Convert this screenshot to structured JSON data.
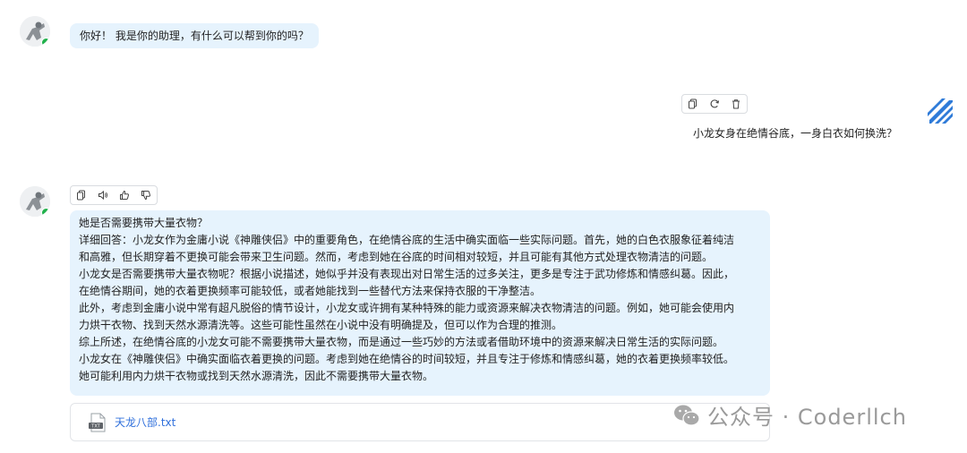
{
  "messages": {
    "greeting": "你好！ 我是你的助理，有什么可以帮到你的吗？",
    "user_question": "小龙女身在绝情谷底，一身白衣如何换洗？",
    "answer_lines": [
      "她是否需要携带大量衣物？",
      "详细回答：小龙女作为金庸小说《神雕侠侣》中的重要角色，在绝情谷底的生活中确实面临一些实际问题。首先，她的白色衣服象征着纯洁",
      "和高雅，但长期穿着不更换可能会带来卫生问题。然而，考虑到她在谷底的时间相对较短，并且可能有其他方式处理衣物清洁的问题。",
      "小龙女是否需要携带大量衣物呢？根据小说描述，她似乎并没有表现出对日常生活的过多关注，更多是专注于武功修炼和情感纠葛。因此，",
      "在绝情谷期间，她的衣着更换频率可能较低，或者她能找到一些替代方法来保持衣服的干净整洁。",
      "此外，考虑到金庸小说中常有超凡脱俗的情节设计，小龙女或许拥有某种特殊的能力或资源来解决衣物清洁的问题。例如，她可能会使用内",
      "力烘干衣物、找到天然水源清洗等。这些可能性虽然在小说中没有明确提及，但可以作为合理的推测。",
      "综上所述，在绝情谷底的小龙女可能不需要携带大量衣物，而是通过一些巧妙的方法或者借助环境中的资源来解决日常生活的实际问题。",
      "小龙女在《神雕侠侣》中确实面临衣着更换的问题。考虑到她在绝情谷的时间较短，并且专注于修炼和情感纠葛，她的衣着更换频率较低。",
      "她可能利用内力烘干衣物或找到天然水源清洗，因此不需要携带大量衣物。"
    ]
  },
  "attachment": {
    "file_name": "天龙八部.txt",
    "file_type": "TXT"
  },
  "watermark": {
    "text": "公众号 · Coderllch"
  },
  "icons": {
    "user_toolbar": [
      "copy-icon",
      "refresh-icon",
      "delete-icon"
    ],
    "answer_toolbar": [
      "copy-icon",
      "speaker-icon",
      "thumbs-up-icon",
      "thumbs-down-icon"
    ]
  },
  "colors": {
    "ai_bubble": "#e6f3fd",
    "online_status": "#22b14c",
    "link": "#2f6fdb",
    "user_avatar": "#2f7bd8"
  }
}
